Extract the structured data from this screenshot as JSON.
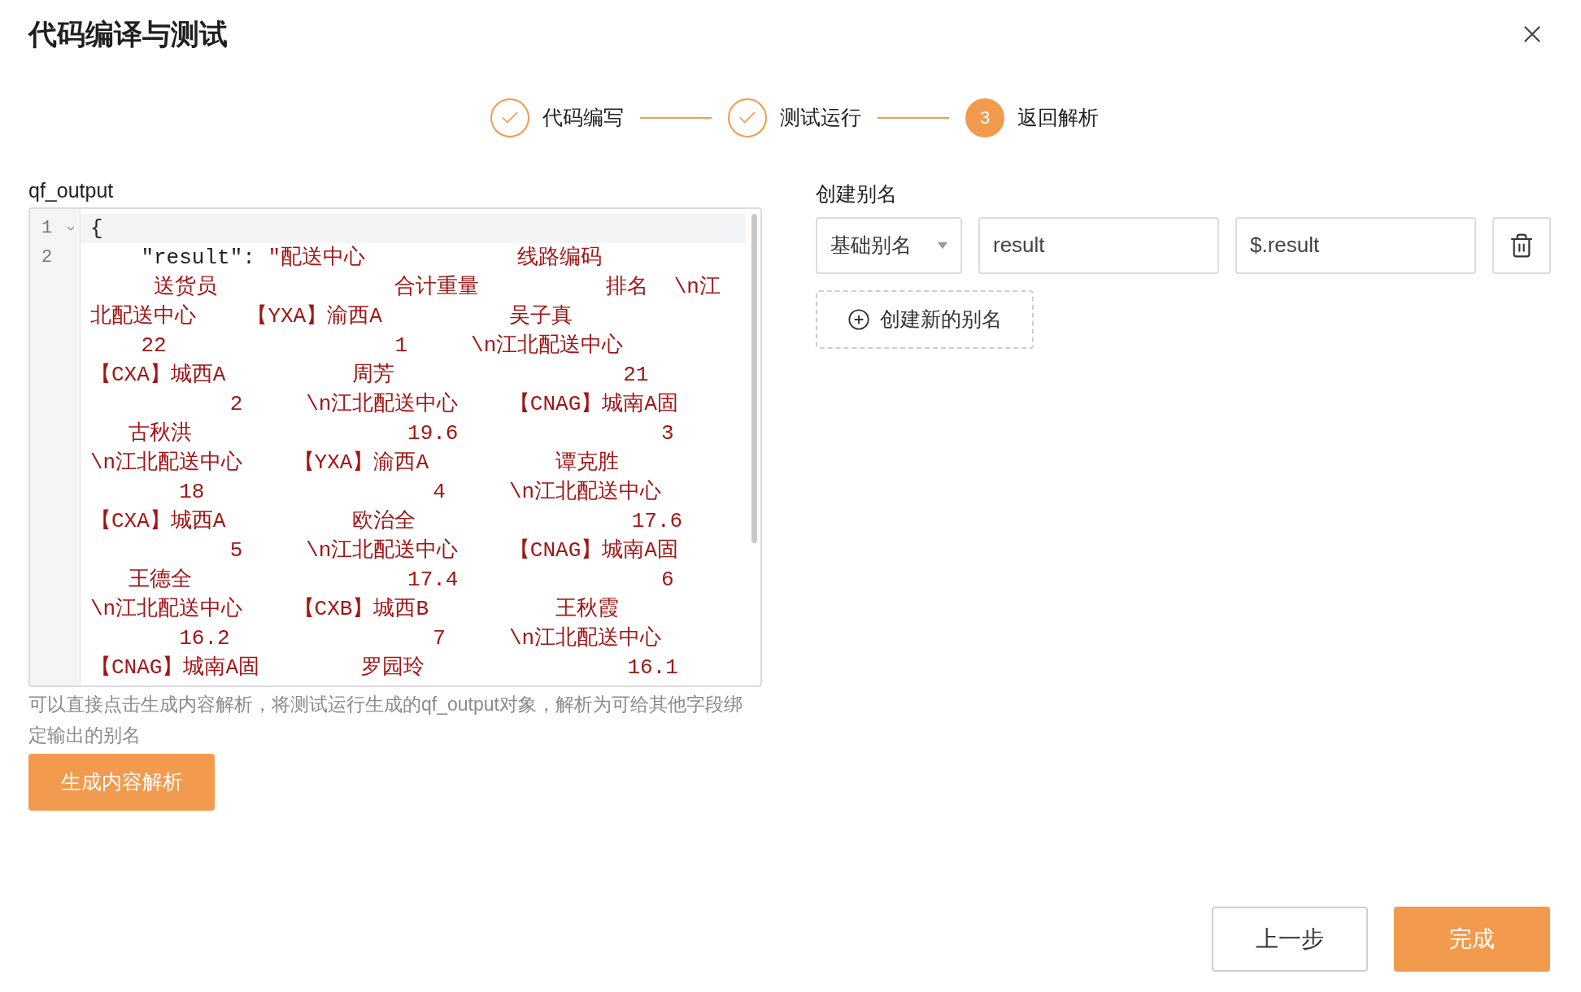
{
  "dialog": {
    "title": "代码编译与测试"
  },
  "steps": [
    {
      "label": "代码编写",
      "completed": true
    },
    {
      "label": "测试运行",
      "completed": true
    },
    {
      "label": "返回解析",
      "completed": false,
      "number": "3"
    }
  ],
  "editor": {
    "label": "qf_output",
    "lines": [
      {
        "number": "1",
        "foldable": true,
        "selected": true,
        "rows": [
          "{"
        ]
      },
      {
        "number": "2",
        "foldable": false,
        "selected": false,
        "key": "    \"result\": ",
        "rows": [
          "\"配送中心            线路编码",
          "     送货员              合计重量          排名  \\n江",
          "北配送中心    【YXA】渝西A          吴子真",
          "    22                  1     \\n江北配送中心",
          "【CXA】城西A          周芳                  21",
          "           2     \\n江北配送中心    【CNAG】城南A固",
          "   古秋洪                 19.6                3",
          "\\n江北配送中心    【YXA】渝西A          谭克胜",
          "       18                  4     \\n江北配送中心",
          "【CXA】城西A          欧治全                 17.6",
          "           5     \\n江北配送中心    【CNAG】城南A固",
          "   王德全                 17.4                6",
          "\\n江北配送中心    【CXB】城西B          王秋霞",
          "       16.2                7     \\n江北配送中心",
          "【CNAG】城南A固        罗园玲                16.1"
        ]
      }
    ]
  },
  "hint": "可以直接点击生成内容解析，将测试运行生成的qf_output对象，解析为可给其他字段绑定输出的别名",
  "generate_button": "生成内容解析",
  "alias": {
    "title": "创建别名",
    "rows": [
      {
        "type": "基础别名",
        "name": "result",
        "path": "$.result"
      }
    ],
    "add_button": "创建新的别名"
  },
  "footer": {
    "prev": "上一步",
    "finish": "完成"
  }
}
